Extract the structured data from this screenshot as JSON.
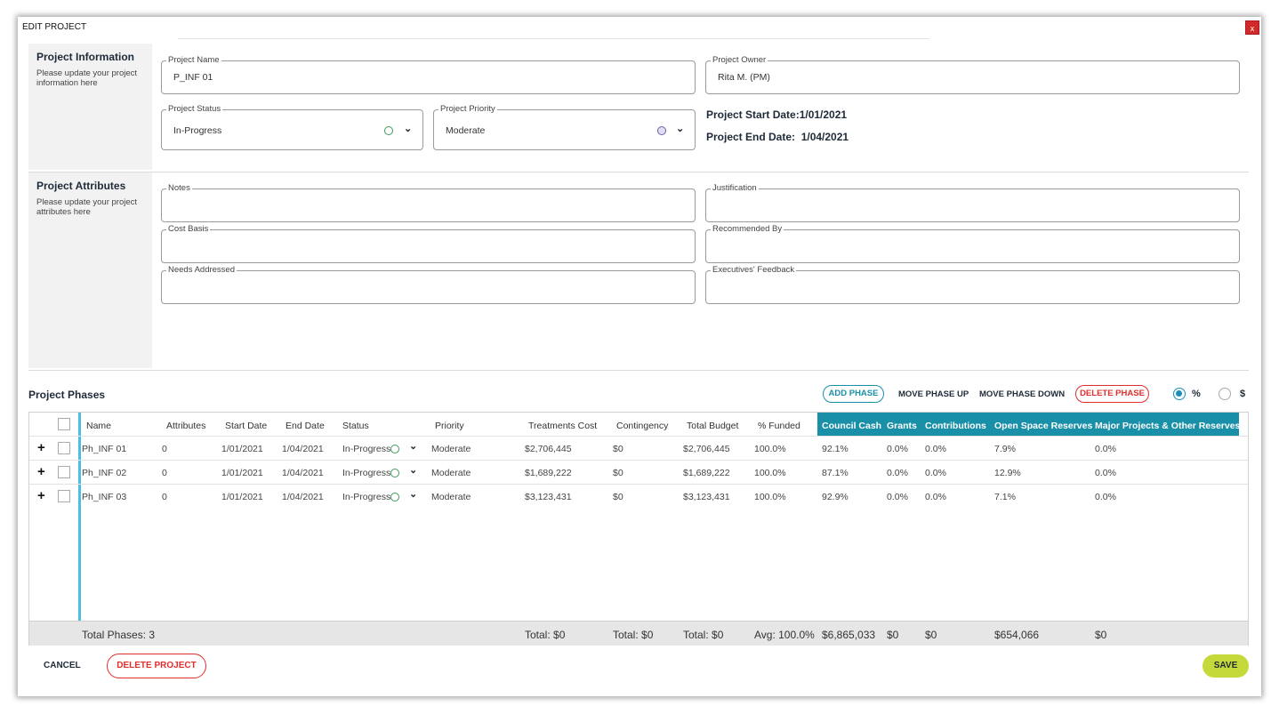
{
  "dialog": {
    "title": "EDIT PROJECT",
    "close_label": "x"
  },
  "project_info": {
    "heading": "Project Information",
    "description": "Please update your project information here",
    "name": {
      "label": "Project Name",
      "value": "P_INF 01"
    },
    "owner": {
      "label": "Project Owner",
      "value": "Rita M. (PM)"
    },
    "status": {
      "label": "Project Status",
      "value": "In-Progress"
    },
    "priority": {
      "label": "Project Priority",
      "value": "Moderate"
    },
    "start_date": "Project Start Date:1/01/2021",
    "end_date": "Project End Date:  1/04/2021"
  },
  "project_attributes": {
    "heading": "Project Attributes",
    "description": "Please update your project attributes here",
    "fields": {
      "notes": "Notes",
      "justification": "Justification",
      "cost_basis": "Cost Basis",
      "recommended_by": "Recommended By",
      "needs_addressed": "Needs Addressed",
      "executives_feedback": "Executives' Feedback"
    }
  },
  "phases": {
    "title": "Project Phases",
    "toolbar": {
      "add_phase": "ADD PHASE",
      "move_up": "MOVE PHASE UP",
      "move_down": "MOVE PHASE DOWN",
      "delete_phase": "DELETE PHASE",
      "percent_label": "%",
      "dollar_label": "$"
    },
    "columns": {
      "name": "Name",
      "attributes": "Attributes",
      "start_date": "Start Date",
      "end_date": "End Date",
      "status": "Status",
      "priority": "Priority",
      "treatments_cost": "Treatments Cost",
      "contingency": "Contingency",
      "total_budget": "Total Budget",
      "funded": "% Funded",
      "council_cash": "Council Cash",
      "grants": "Grants",
      "contributions": "Contributions",
      "open_space": "Open Space Reserves",
      "major_projects": "Major Projects & Other Reserves"
    },
    "rows": [
      {
        "name": "Ph_INF 01",
        "attributes": "0",
        "start": "1/01/2021",
        "end": "1/04/2021",
        "status": "In-Progress",
        "priority": "Moderate",
        "treatments": "$2,706,445",
        "contingency": "$0",
        "budget": "$2,706,445",
        "funded": "100.0%",
        "council": "92.1%",
        "grants": "0.0%",
        "contributions": "0.0%",
        "open_space": "7.9%",
        "major": "0.0%"
      },
      {
        "name": "Ph_INF 02",
        "attributes": "0",
        "start": "1/01/2021",
        "end": "1/04/2021",
        "status": "In-Progress",
        "priority": "Moderate",
        "treatments": "$1,689,222",
        "contingency": "$0",
        "budget": "$1,689,222",
        "funded": "100.0%",
        "council": "87.1%",
        "grants": "0.0%",
        "contributions": "0.0%",
        "open_space": "12.9%",
        "major": "0.0%"
      },
      {
        "name": "Ph_INF 03",
        "attributes": "0",
        "start": "1/01/2021",
        "end": "1/04/2021",
        "status": "In-Progress",
        "priority": "Moderate",
        "treatments": "$3,123,431",
        "contingency": "$0",
        "budget": "$3,123,431",
        "funded": "100.0%",
        "council": "92.9%",
        "grants": "0.0%",
        "contributions": "0.0%",
        "open_space": "7.1%",
        "major": "0.0%"
      }
    ],
    "footer": {
      "total_phases": "Total Phases: 3",
      "treatments_total": "Total: $0",
      "contingency_total": "Total: $0",
      "budget_total": "Total: $0",
      "funded_avg": "Avg: 100.0%",
      "council": "$6,865,033",
      "grants": "$0",
      "contributions": "$0",
      "open_space": "$654,066",
      "major": "$0"
    }
  },
  "actions": {
    "cancel": "CANCEL",
    "delete_project": "DELETE PROJECT",
    "save": "SAVE"
  },
  "colors": {
    "accent": "#1a8fa8",
    "danger": "#e02d2d",
    "save": "#c6d93a",
    "status_circle": "#3a9a5a",
    "priority_circle": "#6a5aa8"
  }
}
